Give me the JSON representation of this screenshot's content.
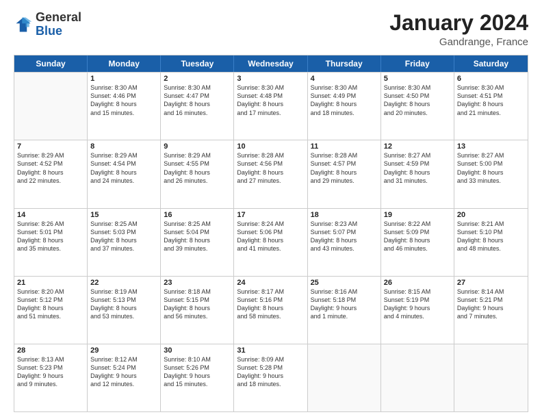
{
  "header": {
    "logo_general": "General",
    "logo_blue": "Blue",
    "month_title": "January 2024",
    "location": "Gandrange, France"
  },
  "days_of_week": [
    "Sunday",
    "Monday",
    "Tuesday",
    "Wednesday",
    "Thursday",
    "Friday",
    "Saturday"
  ],
  "weeks": [
    [
      {
        "day": "",
        "lines": []
      },
      {
        "day": "1",
        "lines": [
          "Sunrise: 8:30 AM",
          "Sunset: 4:46 PM",
          "Daylight: 8 hours",
          "and 15 minutes."
        ]
      },
      {
        "day": "2",
        "lines": [
          "Sunrise: 8:30 AM",
          "Sunset: 4:47 PM",
          "Daylight: 8 hours",
          "and 16 minutes."
        ]
      },
      {
        "day": "3",
        "lines": [
          "Sunrise: 8:30 AM",
          "Sunset: 4:48 PM",
          "Daylight: 8 hours",
          "and 17 minutes."
        ]
      },
      {
        "day": "4",
        "lines": [
          "Sunrise: 8:30 AM",
          "Sunset: 4:49 PM",
          "Daylight: 8 hours",
          "and 18 minutes."
        ]
      },
      {
        "day": "5",
        "lines": [
          "Sunrise: 8:30 AM",
          "Sunset: 4:50 PM",
          "Daylight: 8 hours",
          "and 20 minutes."
        ]
      },
      {
        "day": "6",
        "lines": [
          "Sunrise: 8:30 AM",
          "Sunset: 4:51 PM",
          "Daylight: 8 hours",
          "and 21 minutes."
        ]
      }
    ],
    [
      {
        "day": "7",
        "lines": [
          "Sunrise: 8:29 AM",
          "Sunset: 4:52 PM",
          "Daylight: 8 hours",
          "and 22 minutes."
        ]
      },
      {
        "day": "8",
        "lines": [
          "Sunrise: 8:29 AM",
          "Sunset: 4:54 PM",
          "Daylight: 8 hours",
          "and 24 minutes."
        ]
      },
      {
        "day": "9",
        "lines": [
          "Sunrise: 8:29 AM",
          "Sunset: 4:55 PM",
          "Daylight: 8 hours",
          "and 26 minutes."
        ]
      },
      {
        "day": "10",
        "lines": [
          "Sunrise: 8:28 AM",
          "Sunset: 4:56 PM",
          "Daylight: 8 hours",
          "and 27 minutes."
        ]
      },
      {
        "day": "11",
        "lines": [
          "Sunrise: 8:28 AM",
          "Sunset: 4:57 PM",
          "Daylight: 8 hours",
          "and 29 minutes."
        ]
      },
      {
        "day": "12",
        "lines": [
          "Sunrise: 8:27 AM",
          "Sunset: 4:59 PM",
          "Daylight: 8 hours",
          "and 31 minutes."
        ]
      },
      {
        "day": "13",
        "lines": [
          "Sunrise: 8:27 AM",
          "Sunset: 5:00 PM",
          "Daylight: 8 hours",
          "and 33 minutes."
        ]
      }
    ],
    [
      {
        "day": "14",
        "lines": [
          "Sunrise: 8:26 AM",
          "Sunset: 5:01 PM",
          "Daylight: 8 hours",
          "and 35 minutes."
        ]
      },
      {
        "day": "15",
        "lines": [
          "Sunrise: 8:25 AM",
          "Sunset: 5:03 PM",
          "Daylight: 8 hours",
          "and 37 minutes."
        ]
      },
      {
        "day": "16",
        "lines": [
          "Sunrise: 8:25 AM",
          "Sunset: 5:04 PM",
          "Daylight: 8 hours",
          "and 39 minutes."
        ]
      },
      {
        "day": "17",
        "lines": [
          "Sunrise: 8:24 AM",
          "Sunset: 5:06 PM",
          "Daylight: 8 hours",
          "and 41 minutes."
        ]
      },
      {
        "day": "18",
        "lines": [
          "Sunrise: 8:23 AM",
          "Sunset: 5:07 PM",
          "Daylight: 8 hours",
          "and 43 minutes."
        ]
      },
      {
        "day": "19",
        "lines": [
          "Sunrise: 8:22 AM",
          "Sunset: 5:09 PM",
          "Daylight: 8 hours",
          "and 46 minutes."
        ]
      },
      {
        "day": "20",
        "lines": [
          "Sunrise: 8:21 AM",
          "Sunset: 5:10 PM",
          "Daylight: 8 hours",
          "and 48 minutes."
        ]
      }
    ],
    [
      {
        "day": "21",
        "lines": [
          "Sunrise: 8:20 AM",
          "Sunset: 5:12 PM",
          "Daylight: 8 hours",
          "and 51 minutes."
        ]
      },
      {
        "day": "22",
        "lines": [
          "Sunrise: 8:19 AM",
          "Sunset: 5:13 PM",
          "Daylight: 8 hours",
          "and 53 minutes."
        ]
      },
      {
        "day": "23",
        "lines": [
          "Sunrise: 8:18 AM",
          "Sunset: 5:15 PM",
          "Daylight: 8 hours",
          "and 56 minutes."
        ]
      },
      {
        "day": "24",
        "lines": [
          "Sunrise: 8:17 AM",
          "Sunset: 5:16 PM",
          "Daylight: 8 hours",
          "and 58 minutes."
        ]
      },
      {
        "day": "25",
        "lines": [
          "Sunrise: 8:16 AM",
          "Sunset: 5:18 PM",
          "Daylight: 9 hours",
          "and 1 minute."
        ]
      },
      {
        "day": "26",
        "lines": [
          "Sunrise: 8:15 AM",
          "Sunset: 5:19 PM",
          "Daylight: 9 hours",
          "and 4 minutes."
        ]
      },
      {
        "day": "27",
        "lines": [
          "Sunrise: 8:14 AM",
          "Sunset: 5:21 PM",
          "Daylight: 9 hours",
          "and 7 minutes."
        ]
      }
    ],
    [
      {
        "day": "28",
        "lines": [
          "Sunrise: 8:13 AM",
          "Sunset: 5:23 PM",
          "Daylight: 9 hours",
          "and 9 minutes."
        ]
      },
      {
        "day": "29",
        "lines": [
          "Sunrise: 8:12 AM",
          "Sunset: 5:24 PM",
          "Daylight: 9 hours",
          "and 12 minutes."
        ]
      },
      {
        "day": "30",
        "lines": [
          "Sunrise: 8:10 AM",
          "Sunset: 5:26 PM",
          "Daylight: 9 hours",
          "and 15 minutes."
        ]
      },
      {
        "day": "31",
        "lines": [
          "Sunrise: 8:09 AM",
          "Sunset: 5:28 PM",
          "Daylight: 9 hours",
          "and 18 minutes."
        ]
      },
      {
        "day": "",
        "lines": []
      },
      {
        "day": "",
        "lines": []
      },
      {
        "day": "",
        "lines": []
      }
    ]
  ]
}
